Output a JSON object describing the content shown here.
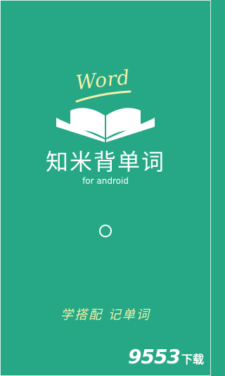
{
  "brand": {
    "logo_word": "Word",
    "app_name": "知米背单词",
    "subtitle": "for android"
  },
  "tagline": "学搭配 记单词",
  "watermark": {
    "number": "9553",
    "suffix": "下载"
  },
  "colors": {
    "background": "#26a886",
    "accent_yellow": "#f5f0a8",
    "text_white": "#ffffff"
  },
  "icons": {
    "book": "open-book-icon",
    "spinner": "loading-spinner"
  }
}
